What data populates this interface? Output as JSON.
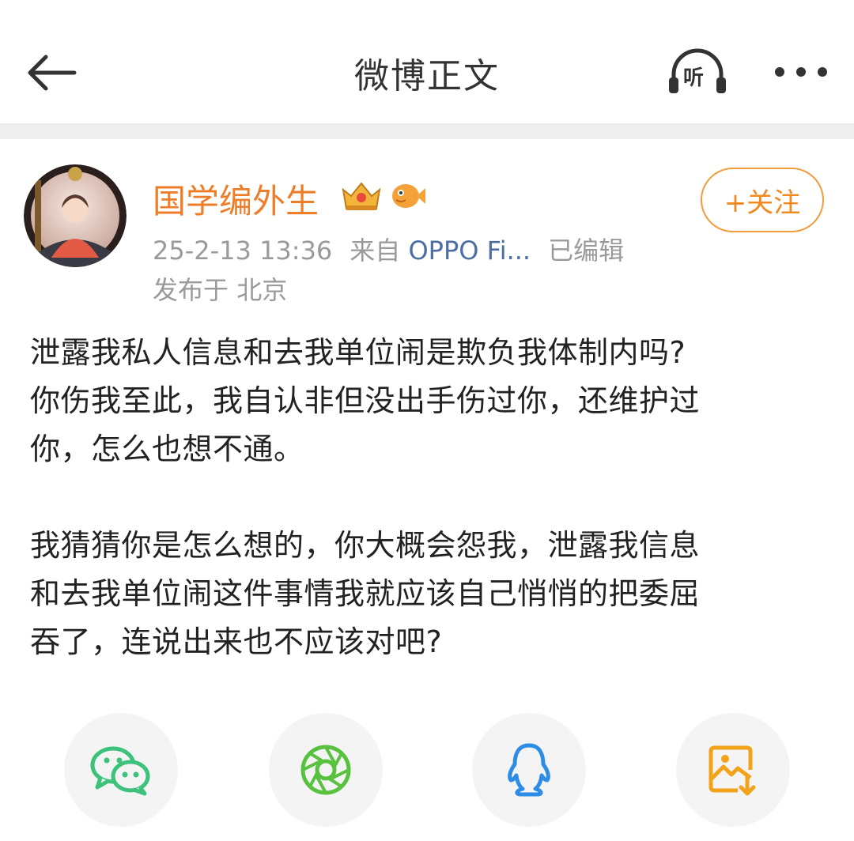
{
  "header": {
    "title": "微博正文",
    "listen_label": "听",
    "back_icon": "arrow-left-icon",
    "more_icon": "more-dots-icon"
  },
  "post": {
    "author": "国学编外生",
    "follow_label": "+关注",
    "timestamp": "25-2-13 13:36",
    "source_prefix": "来自",
    "source_device": "OPPO Fi...",
    "edited": "已编辑",
    "location_prefix": "发布于",
    "location": "北京",
    "lines": [
      "泄露我私人信息和去我单位闹是欺负我体制内吗?",
      "你伤我至此，我自认非但没出手伤过你，还维护过",
      "你，怎么也想不通。",
      "",
      "我猜猜你是怎么想的，你大概会怨我，泄露我信息",
      "和去我单位闹这件事情我就应该自己悄悄的把委屈",
      "吞了，连说出来也不应该对吧?"
    ]
  },
  "share_icons": [
    "wechat-icon",
    "moments-icon",
    "qq-icon",
    "save-image-icon"
  ],
  "colors": {
    "username": "#ee7d2a",
    "follow": "#f08a1e",
    "device": "#4b6fa3",
    "wechat": "#3cc27a",
    "moments": "#58c23f",
    "qq": "#2d8de6",
    "save": "#f3a21b"
  }
}
